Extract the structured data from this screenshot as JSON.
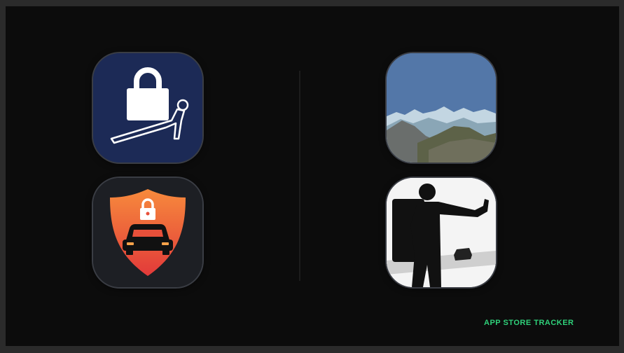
{
  "icons": [
    {
      "name": "padlock-pushup-app-icon",
      "accent": "#1c2a56"
    },
    {
      "name": "car-security-shield-app-icon",
      "accent": "#f0483a"
    },
    {
      "name": "mountain-landscape-app-icon",
      "accent": "#5377a8"
    },
    {
      "name": "hitchhiker-app-icon",
      "accent": "#ffffff"
    }
  ],
  "watermark": {
    "text": "APP STORE TRACKER",
    "color": "#2fd17a"
  }
}
